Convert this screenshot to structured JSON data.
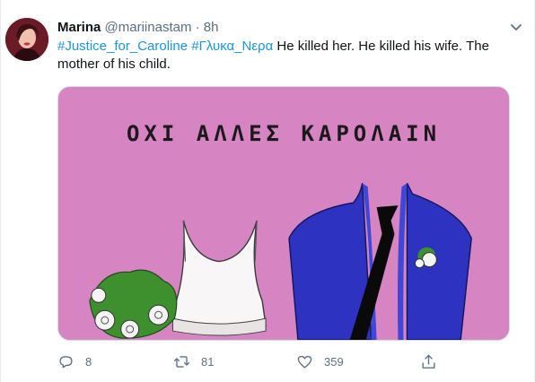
{
  "tweet": {
    "display_name": "Marina",
    "handle": "@mariinastam",
    "separator": "·",
    "time": "8h",
    "hashtag_1": "#Justice_for_Caroline",
    "hashtag_2": "#Γλυκα_Νερα",
    "body_text": " He killed her. He killed his wife. The mother of his child.",
    "image_text": "ΟΧΙ ΑΛΛΕΣ ΚΑΡΟΛΑΙΝ",
    "replies": "8",
    "retweets": "81",
    "likes": "359"
  },
  "icons": {
    "more": "chevron-down-icon",
    "reply": "reply-icon",
    "retweet": "retweet-icon",
    "like": "heart-icon",
    "share": "share-icon"
  },
  "colors": {
    "link": "#1b95e0",
    "secondary_text": "#5b7083",
    "image_background": "#d685c2",
    "suit_blue": "#2d33c0"
  }
}
